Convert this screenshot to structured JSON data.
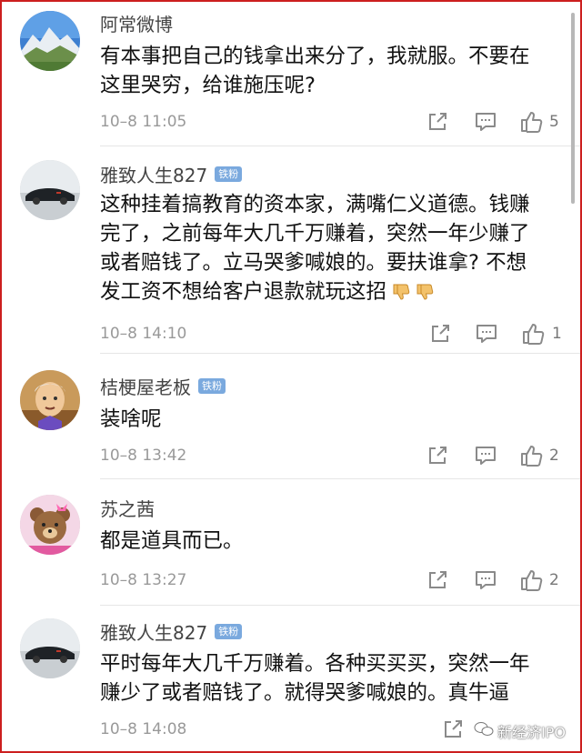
{
  "comments": [
    {
      "username": "阿常微博",
      "badge": "",
      "lines": [
        "有本事把自己的钱拿出来分了，我就服。不要在",
        "这里哭穷，给谁施压呢?"
      ],
      "time": "10–8 11:05",
      "likes": "5"
    },
    {
      "username": "雅致人生827",
      "badge": "铁粉",
      "lines": [
        "这种挂着搞教育的资本家，满嘴仁义道德。钱赚",
        "完了，之前每年大几千万赚着，突然一年少赚了",
        "或者赔钱了。立马哭爹喊娘的。要扶谁拿? 不想",
        "发工资不想给客户退款就玩这招"
      ],
      "emoji": [
        "thumbs-down-icon",
        "thumbs-down-icon"
      ],
      "time": "10–8 14:10",
      "likes": "1"
    },
    {
      "username": "桔梗屋老板",
      "badge": "铁粉",
      "lines": [
        "装啥呢"
      ],
      "time": "10–8 13:42",
      "likes": "2"
    },
    {
      "username": "苏之茜",
      "badge": "",
      "lines": [
        "都是道具而已。"
      ],
      "time": "10–8 13:27",
      "likes": "2"
    },
    {
      "username": "雅致人生827",
      "badge": "铁粉",
      "lines": [
        "平时每年大几千万赚着。各种买买买，突然一年",
        "赚少了或者赔钱了。就得哭爹喊娘的。真牛逼"
      ],
      "time": "10–8 14:08",
      "likes": ""
    }
  ],
  "watermark": "新经济IPO",
  "colors": {
    "badge": "#7aa9de",
    "frame": "#cc1f1f",
    "icon": "#8a8a8a"
  }
}
